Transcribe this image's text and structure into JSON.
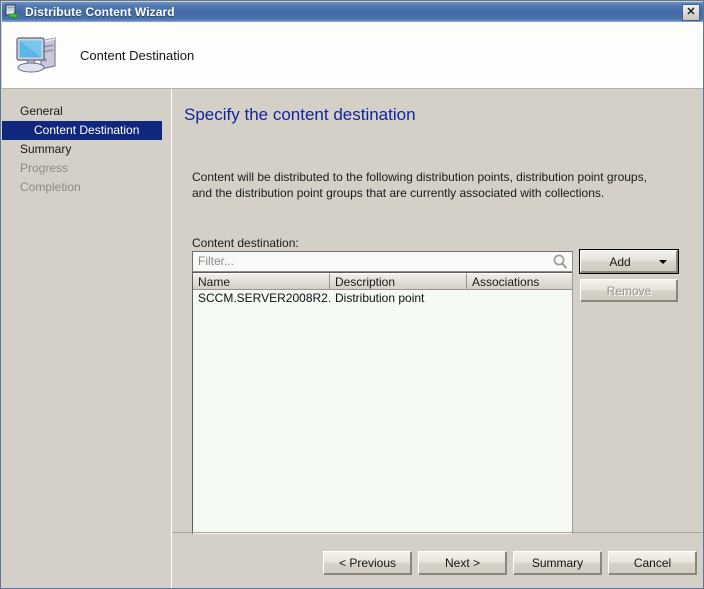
{
  "window": {
    "title": "Distribute Content Wizard",
    "title_icon": "distribute-content-icon",
    "close_label": "✕"
  },
  "banner": {
    "icon": "computer-icon",
    "title": "Content Destination"
  },
  "sidebar": {
    "items": [
      {
        "label": "General",
        "state": "normal",
        "indent": false
      },
      {
        "label": "Content Destination",
        "state": "selected",
        "indent": true
      },
      {
        "label": "Summary",
        "state": "normal",
        "indent": false
      },
      {
        "label": "Progress",
        "state": "disabled",
        "indent": false
      },
      {
        "label": "Completion",
        "state": "disabled",
        "indent": false
      }
    ]
  },
  "main": {
    "heading": "Specify the content destination",
    "description": "Content will be distributed to the following distribution points, distribution point groups, and the distribution point groups that are currently associated with collections.",
    "destination_label": "Content destination:",
    "filter": {
      "value": "",
      "placeholder": "Filter...",
      "icon": "search-icon"
    },
    "table": {
      "columns": [
        "Name",
        "Description",
        "Associations"
      ],
      "rows": [
        [
          "SCCM.SERVER2008R2....",
          "Distribution point",
          ""
        ]
      ]
    },
    "add_button": {
      "label": "Add",
      "arrow_icon": "chevron-down-icon"
    },
    "remove_button": {
      "label": "Remove",
      "enabled": false
    }
  },
  "footer": {
    "previous": "< Previous",
    "next": "Next >",
    "summary": "Summary",
    "cancel": "Cancel"
  },
  "colors": {
    "titlebar_blue": "#4a73ab",
    "selection_blue": "#10277e",
    "heading_blue": "#12259b",
    "window_face": "#d4d0c8",
    "list_background": "#f5faf5"
  }
}
